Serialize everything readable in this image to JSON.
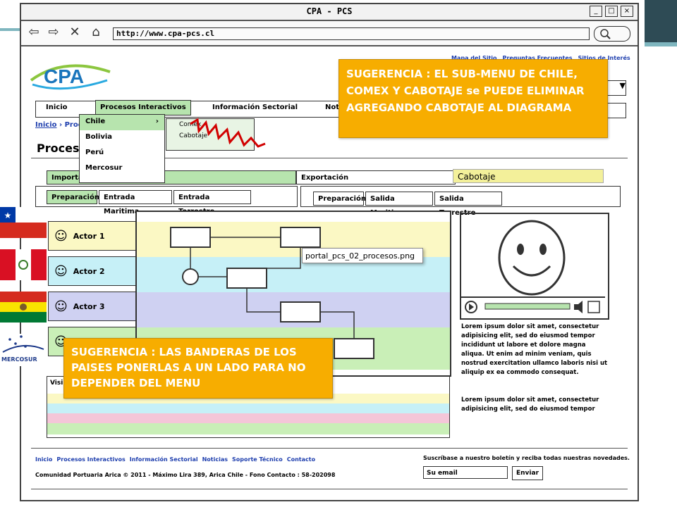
{
  "browser": {
    "title": "CPA - PCS",
    "url": "http://www.cpa-pcs.cl"
  },
  "logo_text": "CPA",
  "top_links": [
    "Mapa del Sitio",
    "Preguntas Frecuentes",
    "Sitios de Interés"
  ],
  "menu": {
    "items": [
      "Inicio",
      "Procesos Interactivos",
      "Información Sectorial",
      "Noti"
    ]
  },
  "submenu": {
    "items": [
      "Chile",
      "Bolivia",
      "Perú",
      "Mercosur"
    ],
    "sub_items": [
      "Comex",
      "Cabotaje"
    ]
  },
  "breadcrumb": {
    "home": "Inicio",
    "current": "Procesos"
  },
  "page_title": "Procesos",
  "tabs": {
    "import": "Importación",
    "export": "Exportación",
    "cabotaje": "Cabotaje",
    "import_sub": [
      "Preparación",
      "Entrada Maritima",
      "Entrada Terrestre"
    ],
    "export_sub": [
      "Preparación",
      "Salida Maritima",
      "Salida Terrestre"
    ]
  },
  "actors": [
    "Actor 1",
    "Actor 2",
    "Actor 3"
  ],
  "diagram_filename": "portal_pcs_02_procesos.png",
  "vis_label": "Visi",
  "lorem1": "Lorem ipsum dolor sit amet, consectetur adipisicing elit, sed do eiusmod tempor incididunt ut labore et dolore magna aliqua. Ut enim ad minim veniam, quis nostrud exercitation ullamco laboris nisi ut aliquip ex ea commodo consequat.",
  "lorem2": "Lorem ipsum dolor sit amet, consectetur adipisicing elit, sed do eiusmod tempor",
  "footer": {
    "links": [
      "Inicio",
      "Procesos Interactivos",
      "Información Sectorial",
      "Noticias",
      "Soporte Técnico",
      "Contacto"
    ],
    "copyright": "Comunidad Portuaria Arica © 2011 - Máximo Lira 389, Arica Chile - Fono Contacto : 58-202098",
    "newsletter": "Suscríbase a nuestro boletín y reciba todas nuestras novedades.",
    "email_placeholder": "Su email",
    "send": "Enviar"
  },
  "notes": {
    "top": "SUGERENCIA : EL SUB-MENU DE CHILE, COMEX Y CABOTAJE se PUEDE ELIMINAR AGREGANDO CABOTAJE AL DIAGRAMA",
    "bottom": "SUGERENCIA : LAS BANDERAS DE LOS PAISES PONERLAS A UN LADO PARA NO DEPENDER DEL MENU"
  },
  "mercosur_label": "MERCOSUR",
  "colors": {
    "note": "#f7ad00",
    "menu_green": "#b7e4ae",
    "lane_yellow": "#fbf8c4",
    "lane_cyan": "#c6f0f7",
    "lane_lavender": "#cfd1f2",
    "lane_green": "#c9efb7"
  }
}
